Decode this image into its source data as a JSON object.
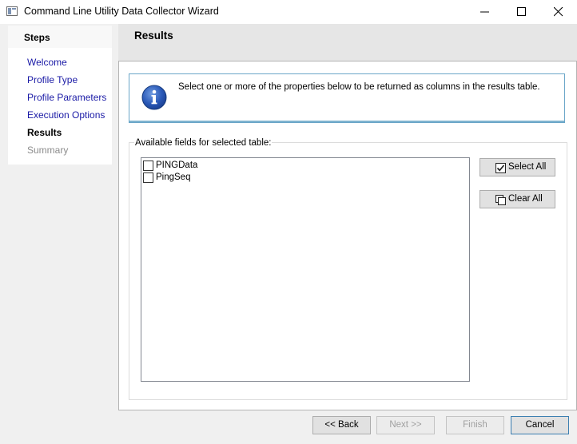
{
  "window": {
    "title": "Command Line Utility Data Collector Wizard",
    "icon": "app-window-icon",
    "controls": [
      "minimize-icon",
      "maximize-icon",
      "close-icon"
    ]
  },
  "steps": {
    "title": "Steps",
    "items": [
      {
        "label": "Welcome",
        "state": "link"
      },
      {
        "label": "Profile Type",
        "state": "link"
      },
      {
        "label": "Profile Parameters",
        "state": "link"
      },
      {
        "label": "Execution Options",
        "state": "link"
      },
      {
        "label": "Results",
        "state": "current"
      },
      {
        "label": "Summary",
        "state": "disabled"
      }
    ]
  },
  "page": {
    "title": "Results",
    "info_text": "Select one or more of the properties below to be returned as columns in the results table.",
    "info_icon": "info-icon"
  },
  "fields": {
    "group_label": "Available fields for selected table:",
    "items": [
      {
        "label": "PINGData",
        "checked": false
      },
      {
        "label": "PingSeq",
        "checked": false
      }
    ],
    "select_all_label": "Select All",
    "clear_all_label": "Clear All"
  },
  "footer": {
    "back_label": "<< Back",
    "next_label": "Next >>",
    "finish_label": "Finish",
    "cancel_label": "Cancel"
  },
  "colors": {
    "link": "#1a1aa6",
    "disabled": "#8c8c8c",
    "info_border": "#6aa6c8"
  }
}
